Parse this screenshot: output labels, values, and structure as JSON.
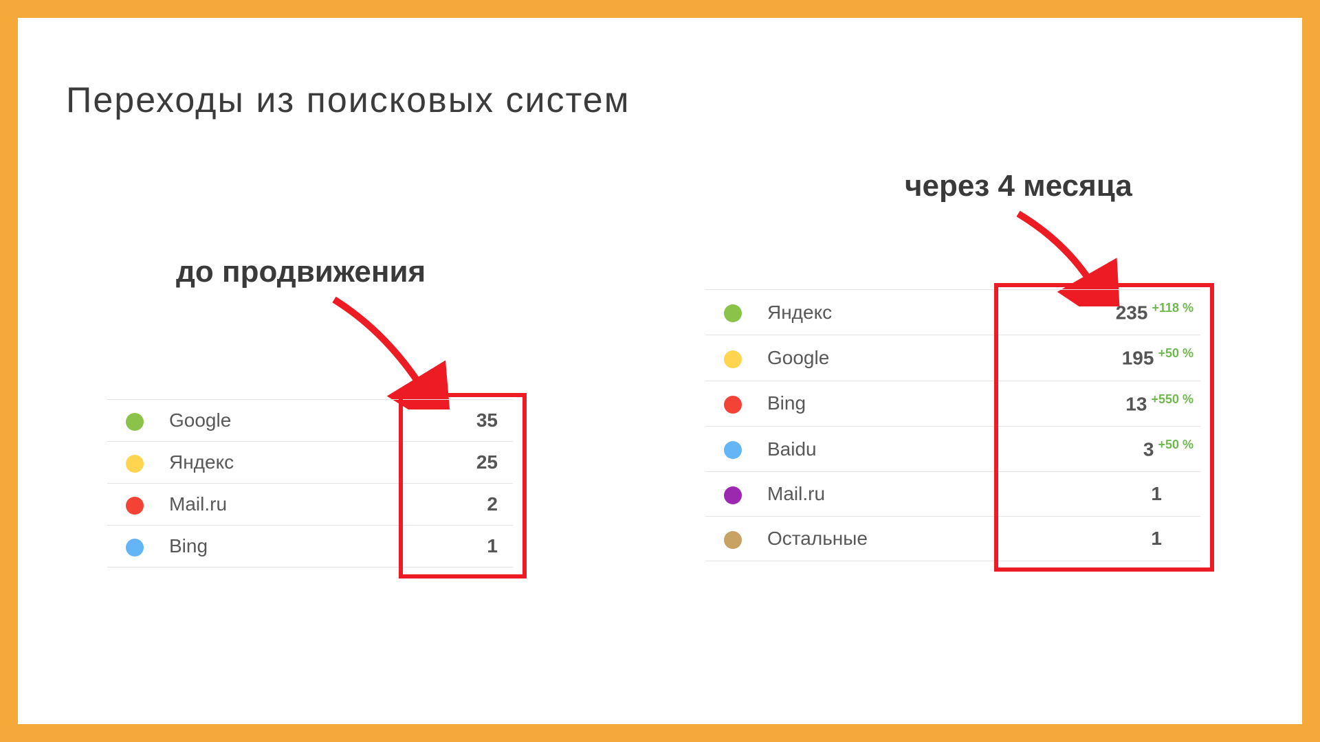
{
  "title": "Переходы из поисковых систем",
  "annotations": {
    "left": "до продвижения",
    "right": "через 4 месяца"
  },
  "colors": {
    "green": "#8bc34a",
    "yellow": "#ffd54f",
    "red": "#f44336",
    "blue": "#64b5f6",
    "purple": "#9c27b0",
    "brown": "#c8a165"
  },
  "before": {
    "rows": [
      {
        "dot": "green",
        "name": "Google",
        "value": "35"
      },
      {
        "dot": "yellow",
        "name": "Яндекс",
        "value": "25"
      },
      {
        "dot": "red",
        "name": "Mail.ru",
        "value": "2"
      },
      {
        "dot": "blue",
        "name": "Bing",
        "value": "1"
      }
    ]
  },
  "after": {
    "rows": [
      {
        "dot": "green",
        "name": "Яндекс",
        "value": "235",
        "delta": "+118 %"
      },
      {
        "dot": "yellow",
        "name": "Google",
        "value": "195",
        "delta": "+50 %"
      },
      {
        "dot": "red",
        "name": "Bing",
        "value": "13",
        "delta": "+550 %"
      },
      {
        "dot": "blue",
        "name": "Baidu",
        "value": "3",
        "delta": "+50 %"
      },
      {
        "dot": "purple",
        "name": "Mail.ru",
        "value": "1",
        "delta": ""
      },
      {
        "dot": "brown",
        "name": "Остальные",
        "value": "1",
        "delta": ""
      }
    ]
  },
  "chart_data": [
    {
      "type": "table",
      "title": "до продвижения",
      "categories": [
        "Google",
        "Яндекс",
        "Mail.ru",
        "Bing"
      ],
      "values": [
        35,
        25,
        2,
        1
      ]
    },
    {
      "type": "table",
      "title": "через 4 месяца",
      "categories": [
        "Яндекс",
        "Google",
        "Bing",
        "Baidu",
        "Mail.ru",
        "Остальные"
      ],
      "values": [
        235,
        195,
        13,
        3,
        1,
        1
      ],
      "delta_percent": [
        118,
        50,
        550,
        50,
        null,
        null
      ]
    }
  ]
}
